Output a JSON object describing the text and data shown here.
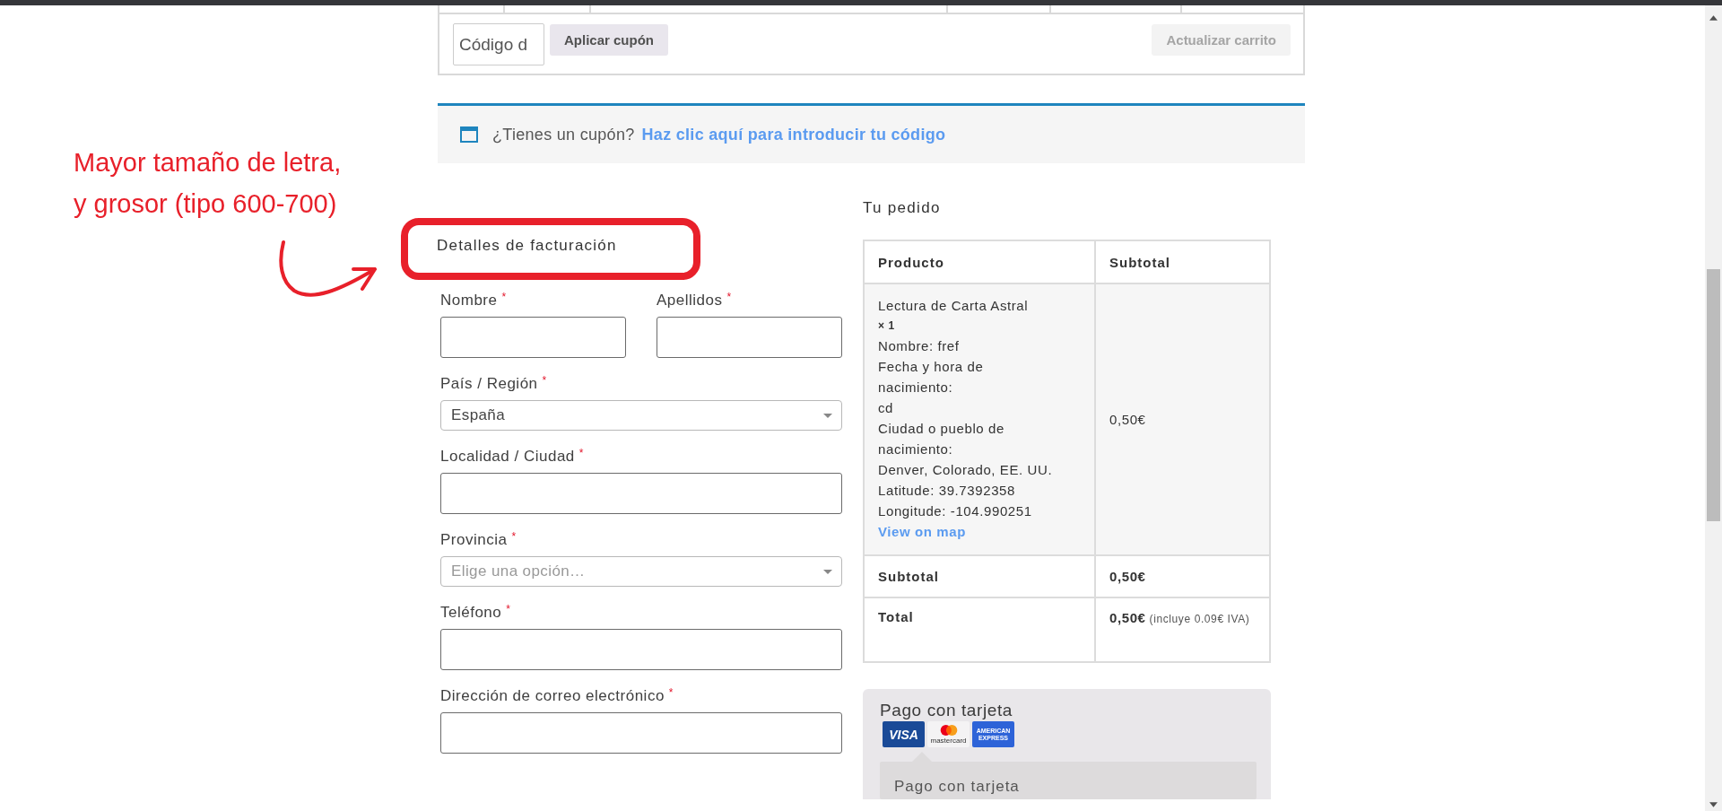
{
  "cart_actions": {
    "coupon_field": {
      "placeholder": "Código d"
    },
    "apply_button": {
      "label": "Aplicar cupón",
      "disabled": false
    },
    "update_button": {
      "label": "Actualizar carrito",
      "disabled": true
    }
  },
  "coupon_notice": {
    "text": "¿Tienes un cupón?",
    "link": "Haz clic aquí para introducir tu código"
  },
  "annotation": {
    "lines": [
      "Mayor tamaño de letra,",
      "y grosor (tipo 600-700)"
    ]
  },
  "billing": {
    "heading": "Detalles de facturación",
    "rows": [
      [
        {
          "kind": "text",
          "label": "Nombre",
          "mark": "*"
        },
        {
          "kind": "text",
          "label": "Apellidos",
          "mark": "*"
        }
      ],
      [
        {
          "kind": "select",
          "label": "País / Región",
          "mark": "*",
          "value": "España"
        }
      ],
      [
        {
          "kind": "text",
          "label": "Localidad / Ciudad",
          "mark": "*"
        }
      ],
      [
        {
          "kind": "select",
          "label": "Provincia",
          "mark": "*",
          "placeholder": "Elige una opción…"
        }
      ],
      [
        {
          "kind": "text",
          "label": "Teléfono",
          "mark": "*"
        }
      ],
      [
        {
          "kind": "text",
          "label": "Dirección de correo electrónico",
          "mark": "*"
        }
      ]
    ]
  },
  "order": {
    "heading": "Tu pedido",
    "columns": [
      "Producto",
      "Subtotal"
    ],
    "item": {
      "name": "Lectura de Carta Astral",
      "quantity": "× 1",
      "lines": [
        "Nombre: fref",
        "Fecha y hora de",
        "nacimiento:",
        "cd",
        "Ciudad o pueblo de",
        "nacimiento:",
        "Denver, Colorado, EE. UU.",
        "Latitude: 39.7392358",
        "Longitude: -104.990251"
      ],
      "link": "View on map",
      "subtotal": "0,50€"
    },
    "subtotal": {
      "label": "Subtotal",
      "amount": "0,50€"
    },
    "total": {
      "label": "Total",
      "amount": "0,50€",
      "tax_note": "(incluye 0.09€ IVA)"
    }
  },
  "payment": {
    "method": "Pago con tarjeta",
    "cards": [
      {
        "kind": "visa",
        "lines": [
          "VISA"
        ]
      },
      {
        "kind": "mastercard",
        "lines": [
          "mastercard"
        ]
      },
      {
        "kind": "amex",
        "lines": [
          "AMERICAN",
          "EXPRESS"
        ]
      }
    ],
    "description": "Pago con tarjeta"
  }
}
